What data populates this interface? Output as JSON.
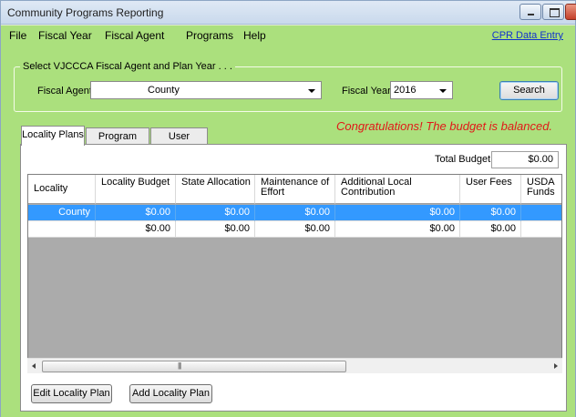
{
  "window": {
    "title": "Community Programs Reporting"
  },
  "menu": {
    "items": [
      "File",
      "Fiscal Year",
      "Fiscal Agent",
      "Programs",
      "Help"
    ],
    "link": "CPR Data Entry"
  },
  "selector": {
    "group_label": "Select VJCCCA Fiscal Agent and Plan Year . . .",
    "fiscal_agent_label": "Fiscal Agent",
    "fiscal_agent_value": "County",
    "fiscal_year_label": "Fiscal Year",
    "fiscal_year_value": "2016",
    "search_label": "Search"
  },
  "status": {
    "message": "Congratulations! The budget is balanced.",
    "color": "#e11818"
  },
  "tabs": [
    "Locality Plans",
    "Program Plans",
    "User Access"
  ],
  "totals": {
    "label": "Total Budget",
    "value": "$0.00"
  },
  "grid": {
    "columns": [
      "Locality",
      "Locality Budget",
      "State Allocation",
      "Maintenance of Effort",
      "Additional Local Contribution",
      "User Fees",
      "USDA Funds"
    ],
    "rows": [
      {
        "selected": true,
        "cells": [
          "County",
          "$0.00",
          "$0.00",
          "$0.00",
          "$0.00",
          "$0.00",
          "$"
        ]
      },
      {
        "selected": false,
        "cells": [
          "",
          "$0.00",
          "$0.00",
          "$0.00",
          "$0.00",
          "$0.00",
          "$"
        ]
      }
    ],
    "selection_color": "#3399ff"
  },
  "actions": {
    "edit_label": "Edit Locality Plan",
    "add_label": "Add Locality Plan"
  },
  "colors": {
    "accent": "#abe07d",
    "link": "#1133cc"
  }
}
